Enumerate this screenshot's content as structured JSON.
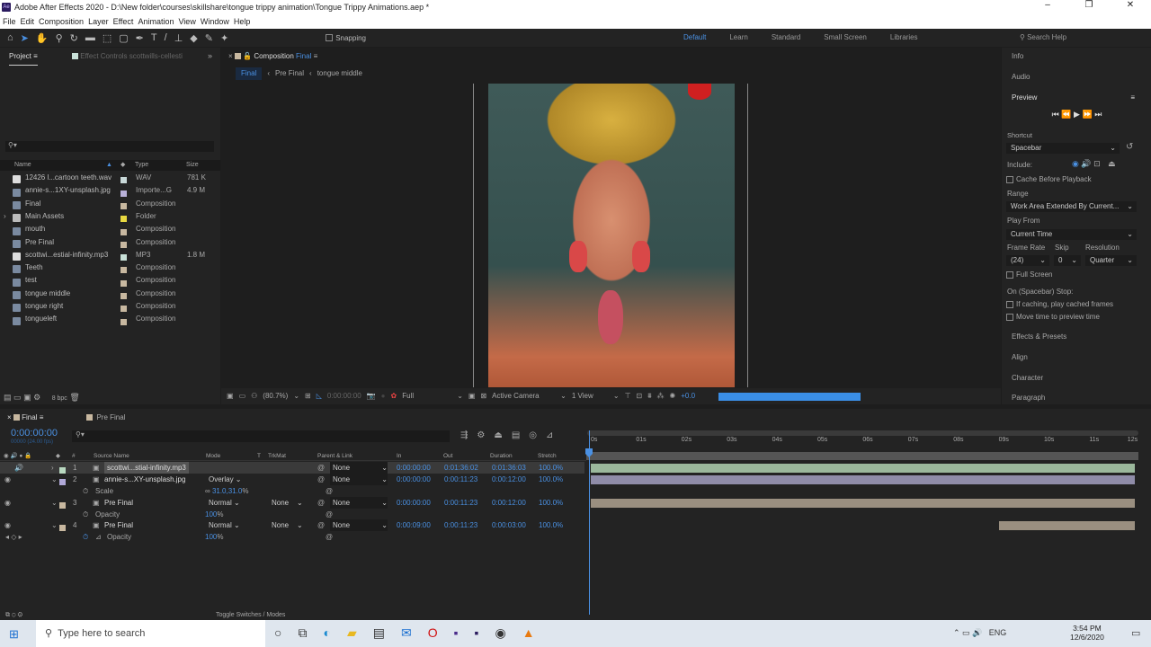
{
  "app": {
    "title": "Adobe After Effects 2020 - D:\\New folder\\courses\\skillshare\\tongue trippy animation\\Tongue Trippy Animations.aep *",
    "logo": "Ae"
  },
  "menu": [
    "File",
    "Edit",
    "Composition",
    "Layer",
    "Effect",
    "Animation",
    "View",
    "Window",
    "Help"
  ],
  "toolbar": {
    "snapping": "Snapping",
    "workspaces": [
      "Default",
      "Learn",
      "Standard",
      "Small Screen",
      "Libraries"
    ],
    "search": "Search Help"
  },
  "project": {
    "tab": "Project",
    "effect_controls": "Effect Controls scottwills-cellesti",
    "columns": [
      "Name",
      "Type",
      "Size"
    ],
    "items": [
      {
        "name": "12426 l...cartoon teeth.wav",
        "type": "WAV",
        "size": "781 K",
        "color": "#c8d8d8",
        "icon": "audio-file-icon"
      },
      {
        "name": "annie-s...1XY-unsplash.jpg",
        "type": "Importe...G",
        "size": "4.9 M",
        "color": "#b8b0d8",
        "icon": "image-file-icon"
      },
      {
        "name": "Final",
        "type": "Composition",
        "size": "",
        "color": "#c8b8a0",
        "icon": "composition-icon"
      },
      {
        "name": "Main Assets",
        "type": "Folder",
        "size": "",
        "color": "#e8d840",
        "icon": "folder-icon"
      },
      {
        "name": "mouth",
        "type": "Composition",
        "size": "",
        "color": "#c8b8a0",
        "icon": "composition-icon"
      },
      {
        "name": "Pre Final",
        "type": "Composition",
        "size": "",
        "color": "#c8b8a0",
        "icon": "composition-icon"
      },
      {
        "name": "scottwi...estial-infinity.mp3",
        "type": "MP3",
        "size": "1.8 M",
        "color": "#c8e0d8",
        "icon": "audio-file-icon"
      },
      {
        "name": "Teeth",
        "type": "Composition",
        "size": "",
        "color": "#c8b8a0",
        "icon": "composition-icon"
      },
      {
        "name": "test",
        "type": "Composition",
        "size": "",
        "color": "#c8b8a0",
        "icon": "composition-icon"
      },
      {
        "name": "tongue middle",
        "type": "Composition",
        "size": "",
        "color": "#c8b8a0",
        "icon": "composition-icon"
      },
      {
        "name": "tongue right",
        "type": "Composition",
        "size": "",
        "color": "#c8b8a0",
        "icon": "composition-icon"
      },
      {
        "name": "tongueleft",
        "type": "Composition",
        "size": "",
        "color": "#c8b8a0",
        "icon": "composition-icon"
      }
    ],
    "bpc": "8 bpc"
  },
  "composition": {
    "tab": "Composition",
    "name": "Final",
    "breadcrumb": [
      "Final",
      "Pre Final",
      "tongue middle"
    ],
    "zoom": "(80.7%)",
    "timecode": "0:00:00:00",
    "resolution": "Full",
    "camera": "Active Camera",
    "view": "1 View",
    "exposure": "+0.0"
  },
  "right": {
    "panels_top": [
      "Info",
      "Audio"
    ],
    "preview": "Preview",
    "shortcut_label": "Shortcut",
    "shortcut": "Spacebar",
    "include": "Include:",
    "cache": "Cache Before Playback",
    "range_label": "Range",
    "range": "Work Area Extended By Current...",
    "playfrom_label": "Play From",
    "playfrom": "Current Time",
    "framerate_label": "Frame Rate",
    "skip_label": "Skip",
    "resolution_label": "Resolution",
    "framerate": "(24)",
    "skip": "0",
    "resolution": "Quarter",
    "fullscreen": "Full Screen",
    "stop_label": "On (Spacebar) Stop:",
    "stop1": "If caching, play cached frames",
    "stop2": "Move time to preview time",
    "panels_bottom": [
      "Effects & Presets",
      "Align",
      "Character",
      "Paragraph"
    ]
  },
  "timeline": {
    "tabs": [
      "Final",
      "Pre Final"
    ],
    "timecode": "0:00:00:00",
    "fps": "00000 (24.00 fps)",
    "columns": [
      "#",
      "Source Name",
      "Mode",
      "T",
      "TrkMat",
      "Parent & Link",
      "In",
      "Out",
      "Duration",
      "Stretch"
    ],
    "layers": [
      {
        "num": "1",
        "name": "scottwi...stial-infinity.mp3",
        "mode": "",
        "trkmat": "",
        "parent": "None",
        "in": "0:00:00:00",
        "out": "0:01:36:02",
        "dur": "0:01:36:03",
        "stretch": "100.0%",
        "color": "#b8d8c0",
        "bar": "#9bb89c",
        "start": 0,
        "end": 12
      },
      {
        "num": "2",
        "name": "annie-s...XY-unsplash.jpg",
        "mode": "Overlay",
        "trkmat": "",
        "parent": "None",
        "in": "0:00:00:00",
        "out": "0:00:11:23",
        "dur": "0:00:12:00",
        "stretch": "100.0%",
        "color": "#b0a8d8",
        "bar": "#8f8ca8",
        "start": 0,
        "end": 12
      },
      {
        "num": "3",
        "name": "Pre Final",
        "mode": "Normal",
        "trkmat": "None",
        "parent": "None",
        "in": "0:00:00:00",
        "out": "0:00:11:23",
        "dur": "0:00:12:00",
        "stretch": "100.0%",
        "color": "#c8b8a0",
        "bar": "#9a8f80",
        "start": 0,
        "end": 12
      },
      {
        "num": "4",
        "name": "Pre Final",
        "mode": "Normal",
        "trkmat": "None",
        "parent": "None",
        "in": "0:00:09:00",
        "out": "0:00:11:23",
        "dur": "0:00:03:00",
        "stretch": "100.0%",
        "color": "#c8b8a0",
        "bar": "#9a8f80",
        "start": 9,
        "end": 12
      }
    ],
    "props": [
      {
        "name": "Scale",
        "value": "31.0,31.0",
        "unit": "%"
      },
      {
        "name": "Opacity",
        "value": "100",
        "unit": "%"
      },
      {
        "name": "Opacity",
        "value": "100",
        "unit": "%"
      }
    ],
    "ruler": [
      "0s",
      "01s",
      "02s",
      "03s",
      "04s",
      "05s",
      "06s",
      "07s",
      "08s",
      "09s",
      "10s",
      "11s",
      "12s"
    ],
    "toggle": "Toggle Switches / Modes"
  },
  "taskbar": {
    "search": "Type here to search",
    "time": "3:54 PM",
    "date": "12/6/2020",
    "lang": "ENG"
  }
}
